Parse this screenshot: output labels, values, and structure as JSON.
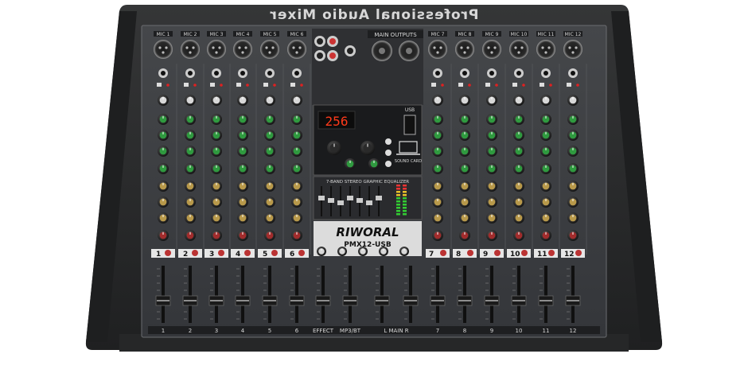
{
  "brand": {
    "title": "Professional Audio Mixer",
    "logo": "RIWORAL",
    "model": "PMX12-USB"
  },
  "sections": {
    "main_outputs": "MAIN OUTPUTS",
    "eq": "7-BAND STEREO GRAPHIC EQUALIZER",
    "effects_display": "256",
    "usb": "USB",
    "sound_card": "SOUND CARD"
  },
  "channels": {
    "left_numbers": [
      "1",
      "2",
      "3",
      "4",
      "5",
      "6"
    ],
    "right_numbers": [
      "7",
      "8",
      "9",
      "10",
      "11",
      "12"
    ],
    "mic_label": "MIC"
  },
  "fader_labels": {
    "channels_left": [
      "1",
      "2",
      "3",
      "4",
      "5",
      "6"
    ],
    "effect": "EFFECT",
    "mp3bt": "MP3/BT",
    "main": "L  MAIN  R",
    "channels_right": [
      "7",
      "8",
      "9",
      "10",
      "11",
      "12"
    ]
  },
  "colors": {
    "body": "#2b2b2b",
    "panel": "#3a3b3c",
    "knob_green": "#2f9a3f",
    "knob_gold": "#b8994a",
    "knob_red": "#a12c2c",
    "knob_white": "#d8d8d8",
    "display": "#ff3a1a"
  }
}
